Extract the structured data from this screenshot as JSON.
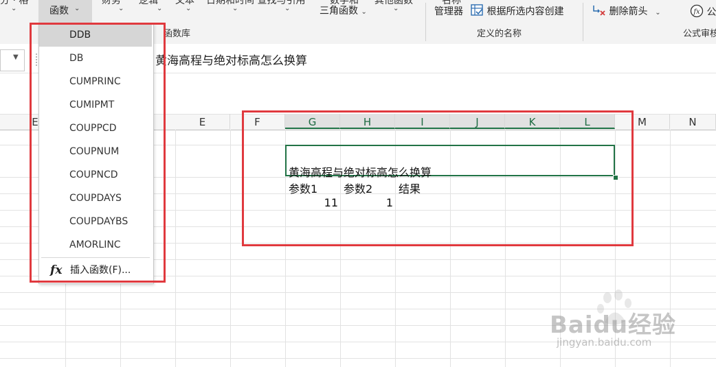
{
  "ribbon": {
    "functions_button_label": "函数",
    "trig_label": "三角函数",
    "name_manager_label": "管理器",
    "create_from_selection_label": "根据所选内容创建",
    "remove_arrows_label": "删除箭头",
    "formula_audit_cut_label": "公",
    "groups": {
      "function_library": "函数库",
      "defined_names": "定义的名称",
      "formula_auditing": "公式审核"
    }
  },
  "formula_bar": {
    "content": "黄海高程与绝对标高怎么换算"
  },
  "columns": [
    "E",
    "F",
    "G",
    "H",
    "I",
    "J",
    "K",
    "L",
    "M",
    "N"
  ],
  "selected_columns": [
    "G",
    "H",
    "I",
    "J",
    "K",
    "L"
  ],
  "column_e_partial": "E",
  "cells": {
    "g4": "黄海高程与绝对标高怎么换算",
    "g5": "参数1",
    "h5": "参数2",
    "i5": "结果",
    "g6": "11",
    "h6": "1"
  },
  "function_dropdown": {
    "items": [
      "DDB",
      "DB",
      "CUMPRINC",
      "CUMIPMT",
      "COUPPCD",
      "COUPNUM",
      "COUPNCD",
      "COUPDAYS",
      "COUPDAYBS",
      "AMORLINC"
    ],
    "highlighted_index": 0,
    "insert_function_label": "插入函数(F)...",
    "fx_glyph": "fx"
  },
  "watermark": {
    "brand": "Baidu经验",
    "url": "jingyan.baidu.com"
  },
  "colors": {
    "excel_green": "#217346",
    "annotation_red": "#e0393e"
  },
  "icons": [
    "dropdown-caret-icon",
    "fx-icon",
    "create-names-icon",
    "remove-arrows-icon",
    "function-circle-icon"
  ]
}
